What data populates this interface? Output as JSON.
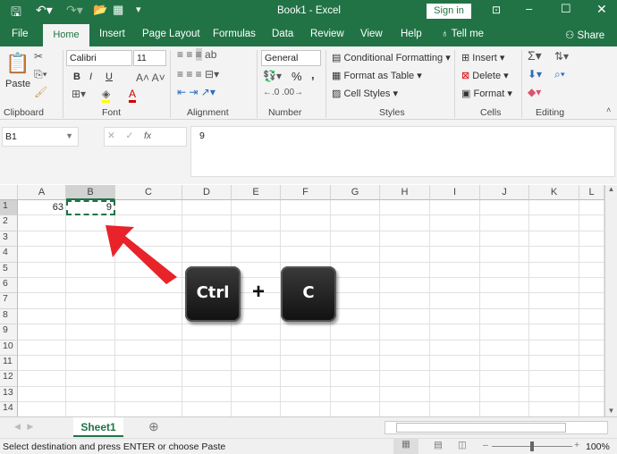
{
  "title": {
    "doc": "Book1 - Excel",
    "sign_in": "Sign in"
  },
  "tabs": [
    "File",
    "Home",
    "Insert",
    "Page Layout",
    "Formulas",
    "Data",
    "Review",
    "View",
    "Help"
  ],
  "tell_me": "Tell me",
  "share": "Share",
  "ribbon": {
    "clipboard": {
      "paste": "Paste",
      "label": "Clipboard"
    },
    "font": {
      "name": "Calibri",
      "size": "11",
      "bold": "B",
      "italic": "I",
      "underline": "U",
      "label": "Font"
    },
    "alignment": {
      "label": "Alignment"
    },
    "number": {
      "format": "General",
      "percent": "%",
      "comma": ",",
      "label": "Number"
    },
    "styles": {
      "conditional": "Conditional Formatting",
      "table": "Format as Table",
      "cell": "Cell Styles",
      "label": "Styles"
    },
    "cells": {
      "insert": "Insert",
      "delete": "Delete",
      "format": "Format",
      "label": "Cells"
    },
    "editing": {
      "label": "Editing"
    }
  },
  "formula_bar": {
    "name_box": "B1",
    "fx": "fx",
    "value": "9"
  },
  "columns": [
    "A",
    "B",
    "C",
    "D",
    "E",
    "F",
    "G",
    "H",
    "I",
    "J",
    "K",
    "L"
  ],
  "rows": [
    "1",
    "2",
    "3",
    "4",
    "5",
    "6",
    "7",
    "8",
    "9",
    "10",
    "11",
    "12",
    "13",
    "14"
  ],
  "cells": {
    "A1": "63",
    "B1": "9"
  },
  "keys": {
    "ctrl": "Ctrl",
    "plus": "+",
    "c": "C"
  },
  "sheet_tab": "Sheet1",
  "status": {
    "message": "Select destination and press ENTER or choose Paste",
    "zoom": "100%",
    "zoom_fraction": 0.5
  },
  "colors": {
    "brand": "#217346",
    "arrow": "#e8232a"
  }
}
